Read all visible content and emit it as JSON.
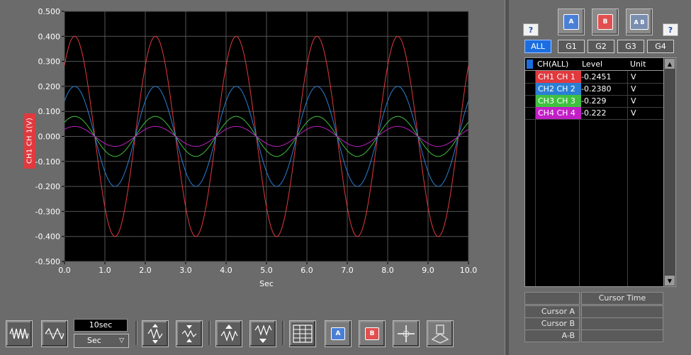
{
  "chart_data": {
    "type": "line",
    "xlabel": "Sec",
    "ylabel": "CH1 CH 1(V)",
    "xlim": [
      0.0,
      10.0
    ],
    "ylim": [
      -0.5,
      0.5
    ],
    "x_ticks": [
      "0.0",
      "1.0",
      "2.0",
      "3.0",
      "4.0",
      "5.0",
      "6.0",
      "7.0",
      "8.0",
      "9.0",
      "10.0"
    ],
    "y_ticks": [
      "0.500",
      "0.400",
      "0.300",
      "0.200",
      "0.100",
      "0.000",
      "-0.100",
      "-0.200",
      "-0.300",
      "-0.400",
      "-0.500"
    ],
    "grid": true,
    "period_sec": 2.0,
    "phase_zero_sec": 0.75,
    "series": [
      {
        "name": "CH1",
        "color": "#e0393e",
        "amplitude": 0.4
      },
      {
        "name": "CH2",
        "color": "#2a7fd4",
        "amplitude": 0.2
      },
      {
        "name": "CH3",
        "color": "#3fc13f",
        "amplitude": 0.08
      },
      {
        "name": "CH4",
        "color": "#c21fc7",
        "amplitude": 0.04
      }
    ]
  },
  "time_range": {
    "value": "10sec",
    "unit": "Sec"
  },
  "right_panel": {
    "help_label": "?",
    "cursor_buttons": [
      "A",
      "B",
      "A B"
    ],
    "groups": [
      "ALL",
      "G1",
      "G2",
      "G3",
      "G4"
    ],
    "table": {
      "headers": [
        "CH(ALL)",
        "Level",
        "Unit"
      ],
      "rows": [
        {
          "channel": "CH1 CH 1",
          "level": "-0.2451",
          "unit": "V",
          "color": "#e0393e"
        },
        {
          "channel": "CH2 CH 2",
          "level": "-0.2380",
          "unit": "V",
          "color": "#2a7fd4"
        },
        {
          "channel": "CH3 CH 3",
          "level": "-0.229",
          "unit": "V",
          "color": "#3fc13f"
        },
        {
          "channel": "CH4 CH 4",
          "level": "-0.222",
          "unit": "V",
          "color": "#c21fc7"
        }
      ]
    },
    "cursor_table": {
      "header": "Cursor Time",
      "rows": [
        "Cursor A",
        "Cursor B",
        "A-B"
      ]
    }
  },
  "colors": {
    "accent": "#1c6ee0",
    "cursor_a": "#4a7fd6",
    "cursor_b": "#e05050"
  }
}
